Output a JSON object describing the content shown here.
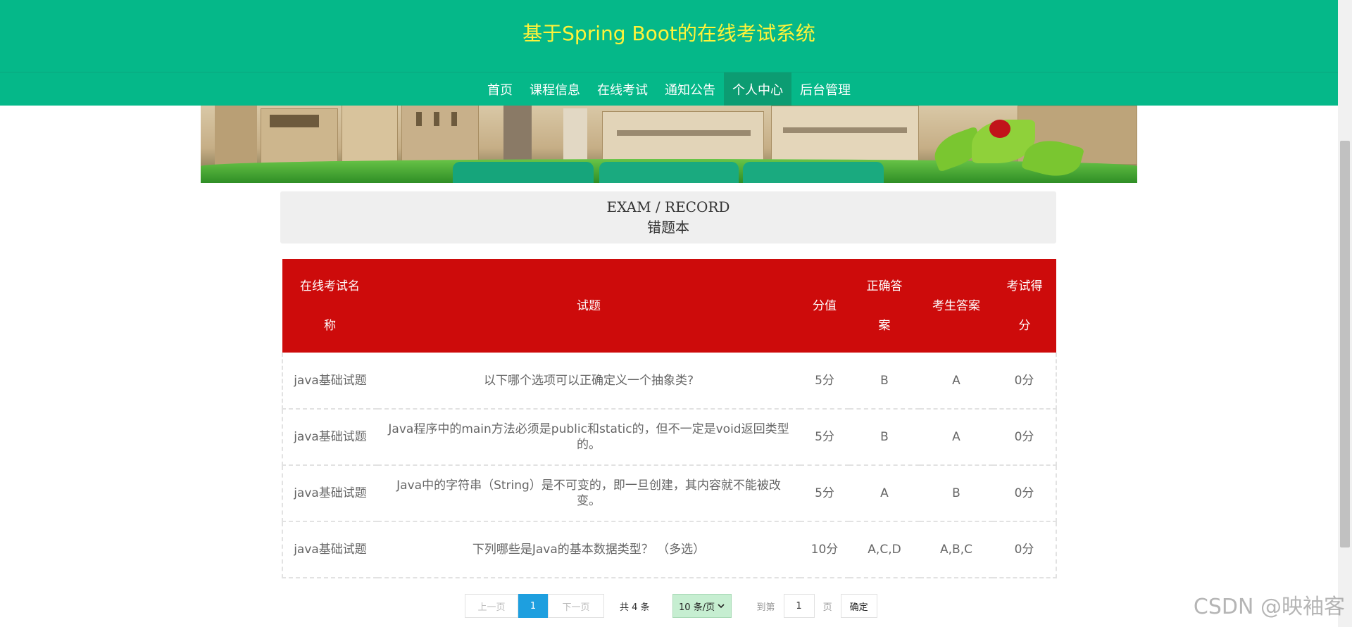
{
  "header": {
    "site_title": "基于Spring Boot的在线考试系统",
    "nav": [
      "首页",
      "课程信息",
      "在线考试",
      "通知公告",
      "个人中心",
      "后台管理"
    ],
    "active_nav": "个人中心"
  },
  "heading": {
    "en": "EXAM / RECORD",
    "cn": "错题本"
  },
  "table": {
    "columns": [
      "在线考试名称",
      "试题",
      "分值",
      "正确答案",
      "考生答案",
      "考试得分"
    ],
    "rows": [
      [
        "java基础试题",
        "以下哪个选项可以正确定义一个抽象类?",
        "5分",
        "B",
        "A",
        "0分"
      ],
      [
        "java基础试题",
        "Java程序中的main方法必须是public和static的，但不一定是void返回类型的。",
        "5分",
        "B",
        "A",
        "0分"
      ],
      [
        "java基础试题",
        "Java中的字符串（String）是不可变的，即一旦创建，其内容就不能被改变。",
        "5分",
        "A",
        "B",
        "0分"
      ],
      [
        "java基础试题",
        "下列哪些是Java的基本数据类型？ （多选）",
        "10分",
        "A,C,D",
        "A,B,C",
        "0分"
      ]
    ]
  },
  "pagination": {
    "prev": "上一页",
    "current": "1",
    "next": "下一页",
    "total": "共 4 条",
    "page_size": "10 条/页",
    "goto_label": "到第",
    "goto_value": "1",
    "page_unit": "页",
    "confirm": "确定"
  },
  "watermark": "CSDN @映袖客",
  "colors": {
    "header_green": "#05b889",
    "title_yellow": "#fff33a",
    "table_header_red": "#cd0b0b",
    "pager_active_blue": "#1e9fdf"
  }
}
